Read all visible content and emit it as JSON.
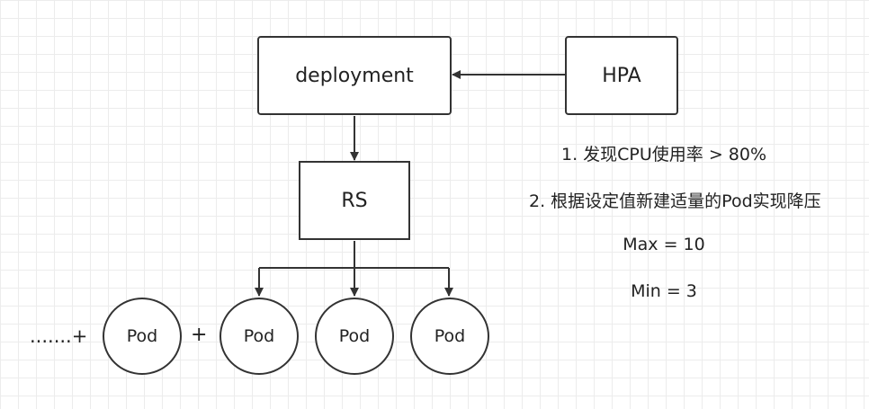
{
  "diagram": {
    "deployment": "deployment",
    "hpa": "HPA",
    "rs": "RS",
    "pods": [
      "Pod",
      "Pod",
      "Pod",
      "Pod"
    ],
    "plus": "+",
    "ellipsis_plus": ".......+",
    "notes": [
      "1. 发现CPU使用率 > 80%",
      "2. 根据设定值新建适量的Pod实现降压",
      "Max = 10",
      "Min = 3"
    ]
  },
  "colors": {
    "stroke": "#333333",
    "grid": "#ececec",
    "text": "#222222"
  }
}
